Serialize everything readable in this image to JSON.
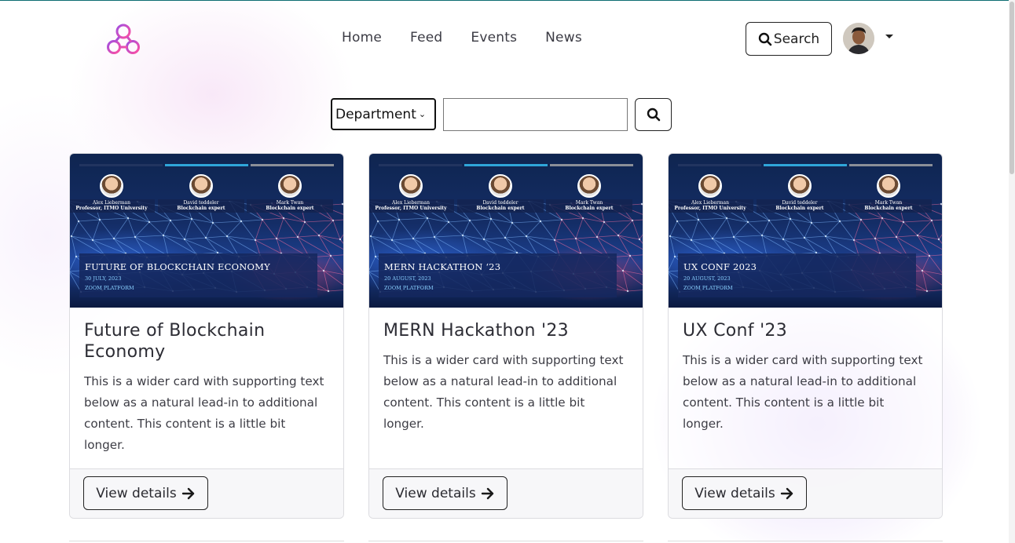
{
  "nav": {
    "links": [
      "Home",
      "Feed",
      "Events",
      "News"
    ],
    "search_label": "Search"
  },
  "filters": {
    "department_selected": "Department",
    "search_value": ""
  },
  "colors": {
    "brand_gradient_start": "#a04ee0",
    "brand_gradient_end": "#ff4fa0",
    "banner_bar_accent": "#2fa6d9"
  },
  "speakers": [
    {
      "name": "Alex Lieberman",
      "role": "Professor, ITMO University"
    },
    {
      "name": "David teddeler",
      "role": "Blockchain expert"
    },
    {
      "name": "Mark Twan",
      "role": "Blockchain expert"
    }
  ],
  "cards": [
    {
      "banner_title": "FUTURE OF BLOCKCHAIN ECONOMY",
      "banner_date": "30 JULY, 2023",
      "banner_place": "ZOOM PLATFORM",
      "title": "Future of Blockchain Economy",
      "description": "This is a wider card with supporting text below as a natural lead-in to additional content. This content is a little bit longer.",
      "button": "View details"
    },
    {
      "banner_title": "MERN HACKATHON ‘23",
      "banner_date": "20 AUGUST,  2023",
      "banner_place": "ZOOM PLATFORM",
      "title": "MERN Hackathon '23",
      "description": "This is a wider card with supporting text below as a natural lead-in to additional content. This content is a little bit longer.",
      "button": "View details"
    },
    {
      "banner_title": "UX CONF 2023",
      "banner_date": "20 AUGUST,  2023",
      "banner_place": "ZOOM PLATFORM",
      "title": "UX Conf '23",
      "description": "This is a wider card with supporting text below as a natural lead-in to additional content. This content is a little bit longer.",
      "button": "View details"
    }
  ]
}
